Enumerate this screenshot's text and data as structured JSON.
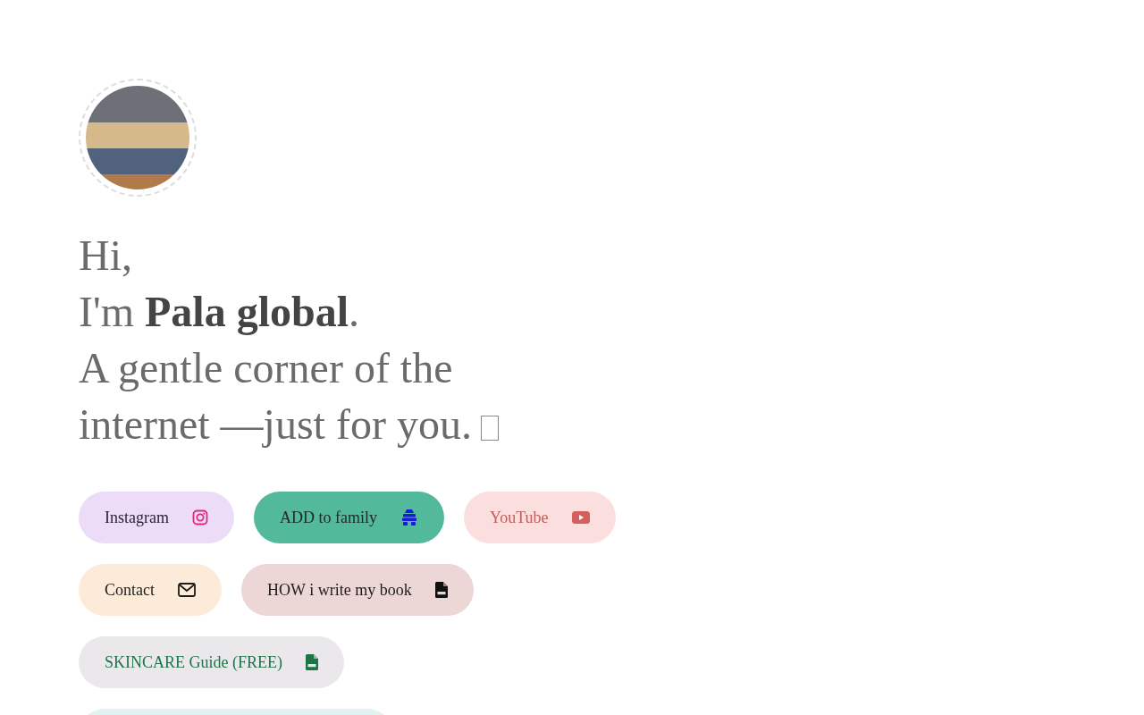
{
  "profile": {
    "greeting": "Hi,",
    "intro": "I'm **Pala global**.",
    "tagline": "A gentle corner of the internet —just for you."
  },
  "links": [
    {
      "color": "#ecdcf8",
      "label": {
        "text": "Instagram",
        "color": "#2a2438"
      },
      "icon": {
        "kind": "instagram",
        "color": "#e1287f"
      }
    },
    {
      "color": "#52b99a",
      "label": {
        "text": "ADD to family",
        "color": "#1c2a24"
      },
      "icon": {
        "kind": "hive",
        "color": "#1a1ad8"
      }
    },
    {
      "color": "#fbdfdf",
      "label": {
        "text": "YouTube",
        "color": "#c0605e"
      },
      "icon": {
        "kind": "youtube",
        "color": "#d4605e"
      }
    },
    {
      "color": "#fcebd8",
      "label": {
        "text": "Contact",
        "color": "#1c1c1c"
      },
      "icon": {
        "kind": "mail",
        "color": "#1c1c1c"
      }
    },
    {
      "color": "#ecd6d6",
      "label": {
        "text": "HOW i write my book",
        "color": "#1c1c1c"
      },
      "icon": {
        "kind": "pdf",
        "color": "#111111"
      }
    },
    {
      "color": "#ebe8ec",
      "label": {
        "text": "SKINCARE Guide (FREE)",
        "color": "#1e7448"
      },
      "icon": {
        "kind": "pdf",
        "color": "#1e7448"
      }
    },
    {
      "color": "#e3f1f0"
    }
  ]
}
